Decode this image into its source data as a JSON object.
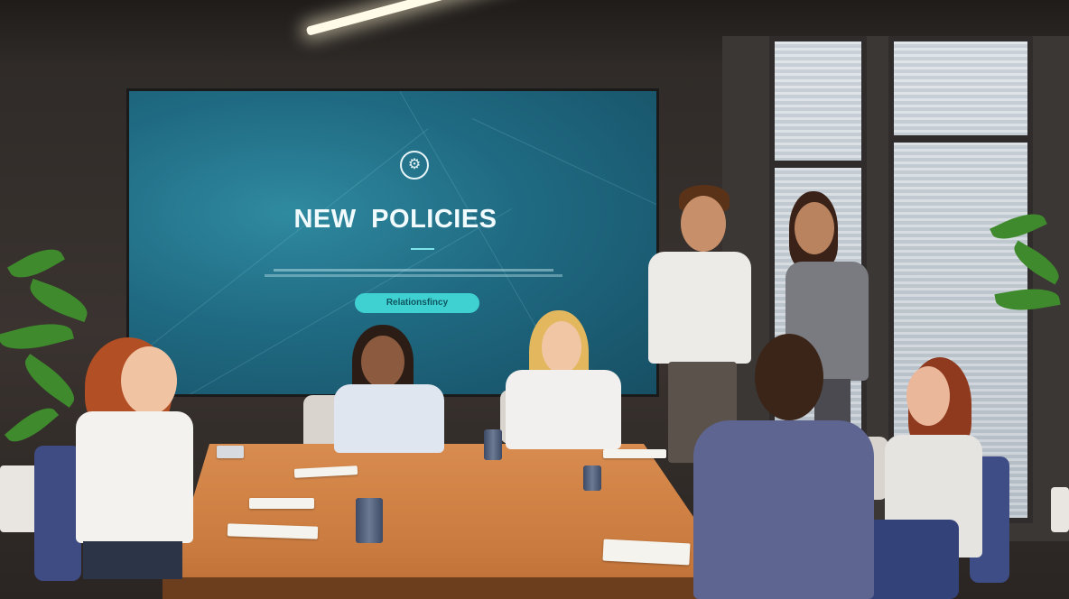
{
  "scene": {
    "description_colors": {
      "screen": "#1f6a82",
      "table": "#d98c4f",
      "wall": "#3a3330"
    }
  },
  "screen": {
    "logo_icon": "gear-head-logo-icon",
    "title": "NEW POLICIES",
    "body_text": "",
    "button_label": "Relationsfincy"
  }
}
